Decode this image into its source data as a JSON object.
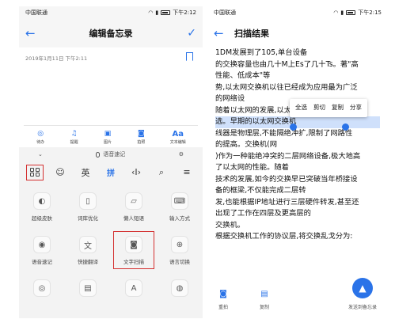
{
  "left": {
    "status": {
      "carrier": "中国联通",
      "time": "下午2:12"
    },
    "appbar": {
      "title": "编辑备忘录"
    },
    "note": {
      "date": "2019年1月11日 下午2:11"
    },
    "tools": [
      {
        "icon": "check-icon",
        "label": "待办"
      },
      {
        "icon": "bell-icon",
        "label": "提醒"
      },
      {
        "icon": "image-icon",
        "label": "图片"
      },
      {
        "icon": "camera-icon",
        "label": "拍照"
      },
      {
        "icon": "text-format-icon",
        "label": "文本编辑"
      }
    ],
    "kbar": {
      "label": "语音速记"
    },
    "ime": {
      "en": "英",
      "pinyin": "拼"
    },
    "panel": [
      [
        {
          "label": "超级皮肤"
        },
        {
          "label": "词库优化"
        },
        {
          "label": "懒人短语"
        },
        {
          "label": "输入方式"
        }
      ],
      [
        {
          "label": "语音速记"
        },
        {
          "label": "快捷翻译"
        },
        {
          "label": "文字扫描"
        },
        {
          "label": "语言切换"
        }
      ],
      [
        {
          "label": ""
        },
        {
          "label": ""
        },
        {
          "label": ""
        },
        {
          "label": ""
        }
      ]
    ]
  },
  "right": {
    "status": {
      "carrier": "中国联通",
      "time": "下午2:15"
    },
    "appbar": {
      "title": "扫描结果"
    },
    "ocr": [
      "1DM发展到了105,单台设备",
      "的交换容量也由几十M上Es了几十Ts。著\"高",
      "性能、低成本\"等",
      "势,以太网交换机以往已经成为应用最为广泛",
      "的网络设",
      "随着以太网的发展,以太网交换机也在持续演",
      "选。早期的以太网交换机",
      "线器是物理层,不能隔绝冲扩,限制了网路性",
      "的提高。交换机(网",
      ")作为一种能绝冲突的二层网络设备,极大地高",
      "了以太网的性能。随着",
      "技术的发展,如今的交换早已突破当年桥接设",
      "备的框梁,不仅能完成二层转",
      "发,也能根据IP地址进行三层硬件转发,甚至还",
      "出现了工作在四层及更高层的",
      "交换机。",
      "根据交换机工作的协议层,将交换乱戈分为:"
    ],
    "popup": [
      "全选",
      "剪切",
      "复制",
      "分享"
    ],
    "bottom": {
      "retake": "重拍",
      "copy": "复制",
      "send": "发送到备忘录"
    }
  }
}
